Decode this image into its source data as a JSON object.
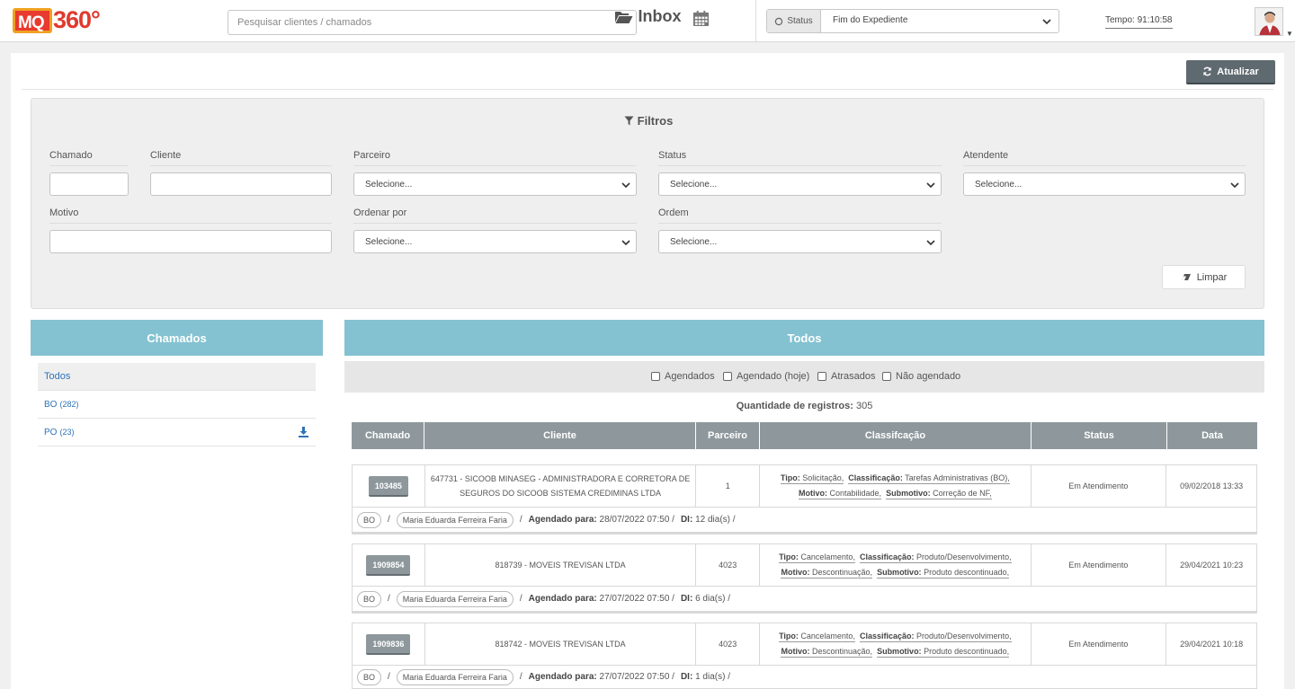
{
  "header": {
    "logo_mq": "MQ",
    "logo_360": "360°",
    "search_placeholder": "Pesquisar clientes / chamados",
    "status_label": "Status",
    "status_value": "Fim do Expediente",
    "tempo": "Tempo: 91:10:58"
  },
  "page": {
    "title": "Inbox",
    "refresh_label": "Atualizar"
  },
  "filters": {
    "title": "Filtros",
    "chamado_label": "Chamado",
    "cliente_label": "Cliente",
    "parceiro_label": "Parceiro",
    "status_label": "Status",
    "atendente_label": "Atendente",
    "motivo_label": "Motivo",
    "ordenar_label": "Ordenar por",
    "ordem_label": "Ordem",
    "select_placeholder": "Selecione...",
    "clear_label": "Limpar"
  },
  "left_panel": {
    "title": "Chamados",
    "items": [
      {
        "label": "Todos",
        "count": ""
      },
      {
        "label": "BO",
        "count": "(282)"
      },
      {
        "label": "PO",
        "count": "(23)"
      }
    ]
  },
  "right_panel": {
    "title": "Todos",
    "checkboxes": [
      "Agendados",
      "Agendado (hoje)",
      "Atrasados",
      "Não agendado"
    ],
    "records_label": "Quantidade de registros:",
    "records_count": "305",
    "columns": [
      "Chamado",
      "Cliente",
      "Parceiro",
      "Classifcação",
      "Status",
      "Data"
    ],
    "tickets": [
      {
        "id": "103485",
        "cliente": "647731 - SICOOB MINASEG - ADMINISTRADORA E CORRETORA DE SEGUROS DO SICOOB SISTEMA CREDIMINAS LTDA",
        "parceiro": "1",
        "tipo": "Solicitação,",
        "classificacao": "Tarefas Administrativas (BO),",
        "motivo": "Contabilidade,",
        "submotivo": "Correção de NF,",
        "status": "Em Atendimento",
        "data": "09/02/2018 13:33",
        "fila": "BO",
        "atendente": "Maria Eduarda Ferreira Faria",
        "agendado": "28/07/2022 07:50 /",
        "di": "12 dia(s) /"
      },
      {
        "id": "1909854",
        "cliente": "818739 - MOVEIS TREVISAN LTDA",
        "parceiro": "4023",
        "tipo": "Cancelamento,",
        "classificacao": "Produto/Desenvolvimento,",
        "motivo": "Descontinuação,",
        "submotivo": "Produto descontinuado,",
        "status": "Em Atendimento",
        "data": "29/04/2021 10:23",
        "fila": "BO",
        "atendente": "Maria Eduarda Ferreira Faria",
        "agendado": "27/07/2022 07:50 /",
        "di": "6 dia(s) /"
      },
      {
        "id": "1909836",
        "cliente": "818742 - MOVEIS TREVISAN LTDA",
        "parceiro": "4023",
        "tipo": "Cancelamento,",
        "classificacao": "Produto/Desenvolvimento,",
        "motivo": "Descontinuação,",
        "submotivo": "Produto descontinuado,",
        "status": "Em Atendimento",
        "data": "29/04/2021 10:18",
        "fila": "BO",
        "atendente": "Maria Eduarda Ferreira Faria",
        "agendado": "27/07/2022 07:50 /",
        "di": "1 dia(s) /"
      }
    ],
    "labels": {
      "tipo": "Tipo:",
      "classificacao": "Classificação:",
      "motivo": "Motivo:",
      "submotivo": "Submotivo:",
      "agendado_para": "Agendado para:",
      "di": "DI:",
      "sep": "/"
    }
  }
}
